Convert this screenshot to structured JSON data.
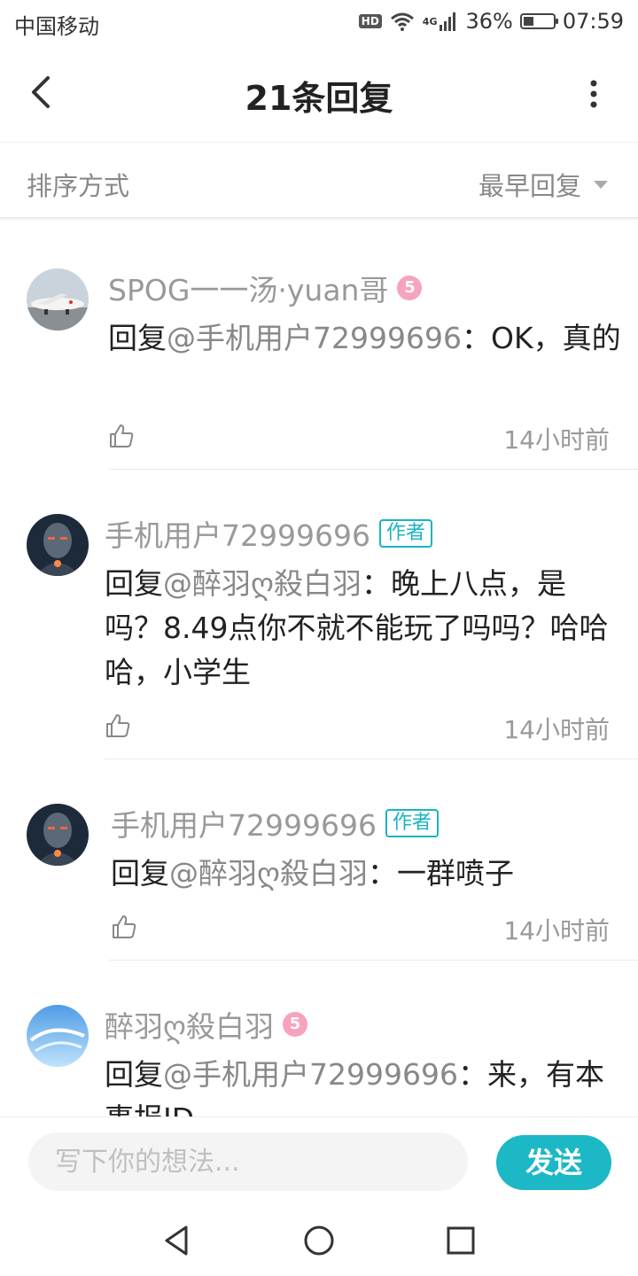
{
  "status_bar": {
    "carrier": "中国移动",
    "network": "4G",
    "hd": "HD",
    "battery": "36%",
    "battery_level": 0.36,
    "time": "07:59"
  },
  "header": {
    "title": "21条回复"
  },
  "sort": {
    "label": "排序方式",
    "selected": "最早回复"
  },
  "comments": [
    {
      "username": "SPOG一一汤·yuan哥",
      "level": "5",
      "is_author": false,
      "reply_prefix": "回复",
      "mention": "@手机用户72999696",
      "text": "：OK，真的",
      "time": "14小时前",
      "avatar": "airplane-avatar"
    },
    {
      "username": "手机用户72999696",
      "is_author": true,
      "author_badge": "作者",
      "reply_prefix": "回复",
      "mention": "@醉羽ღ殺白羽",
      "text": "：晚上八点，是吗？8.49点你不就不能玩了吗吗？哈哈哈，小学生",
      "time": "14小时前",
      "avatar": "robot-avatar"
    },
    {
      "username": "手机用户72999696",
      "is_author": true,
      "author_badge": "作者",
      "reply_prefix": "回复",
      "mention": "@醉羽ღ殺白羽",
      "text": "：一群喷子",
      "time": "14小时前",
      "avatar": "robot-avatar"
    },
    {
      "username": "醉羽ღ殺白羽",
      "level": "5",
      "is_author": false,
      "reply_prefix": "回复",
      "mention": "@手机用户72999696",
      "text": "：来，有本事报ID",
      "time": "",
      "avatar": "sky-avatar"
    }
  ],
  "input": {
    "placeholder": "写下你的想法...",
    "send_label": "发送"
  },
  "colors": {
    "accent": "#1cb8c6",
    "level_badge": "#f7a3ba",
    "secondary_text": "#999999"
  }
}
